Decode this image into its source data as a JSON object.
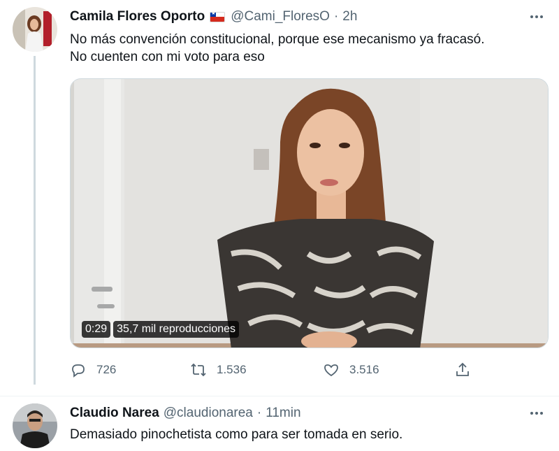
{
  "tweet1": {
    "display_name": "Camila Flores Oporto",
    "handle": "@Cami_FloresO",
    "separator": "·",
    "time": "2h",
    "text_line1": "No más convención constitucional, porque ese mecanismo ya fracasó.",
    "text_line2": "No cuenten con mi voto para eso",
    "video": {
      "duration": "0:29",
      "views": "35,7 mil reproducciones"
    },
    "actions": {
      "replies": "726",
      "retweets": "1.536",
      "likes": "3.516"
    }
  },
  "tweet2": {
    "display_name": "Claudio Narea",
    "handle": "@claudionarea",
    "separator": "·",
    "time": "11min",
    "text": "Demasiado pinochetista como para ser tomada en serio."
  },
  "colors": {
    "text": "#0f1419",
    "secondary": "#536471",
    "border": "#cfd9de"
  }
}
